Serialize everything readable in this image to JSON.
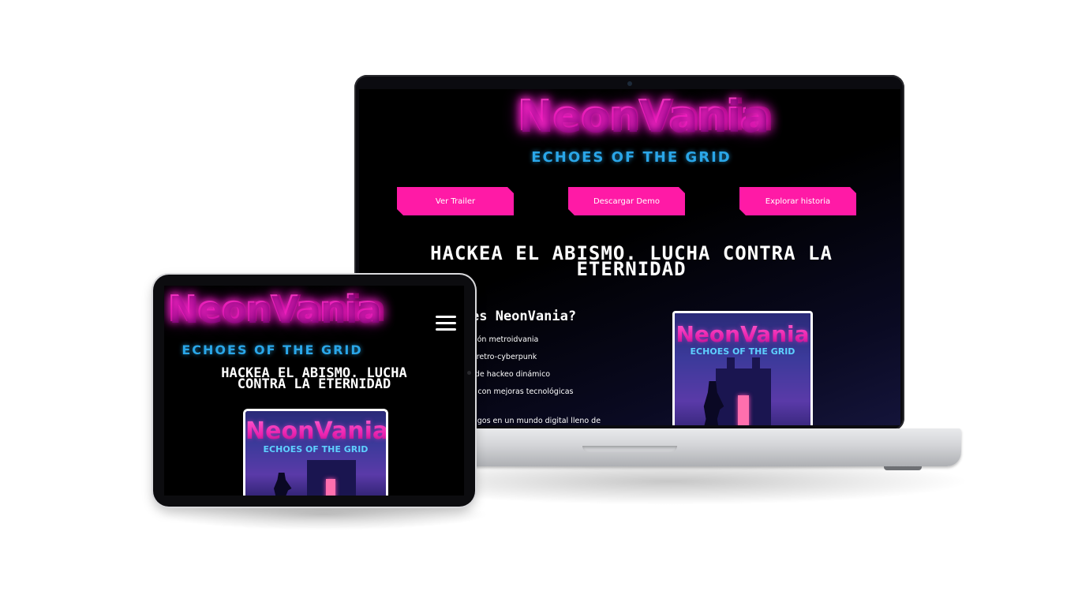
{
  "brand": {
    "title": "NeonVania",
    "subtitle": "ECHOES OF THE GRID"
  },
  "laptop": {
    "buttons": [
      {
        "label": "Ver Trailer"
      },
      {
        "label": "Descargar Demo"
      },
      {
        "label": "Explorar historia"
      }
    ],
    "hero": "HACKEA EL ABISMO. LUCHA CONTRA LA ETERNIDAD",
    "question": "es NeonVania?",
    "features": [
      "ración metroidvania",
      "ica retro-cyberpunk",
      "na de hackeo dinámico",
      "ate con mejoras tecnológicas",
      "emigos en un mundo digital lleno de"
    ]
  },
  "tablet": {
    "hero": "HACKEA EL ABISMO. LUCHA CONTRA LA ETERNIDAD"
  },
  "cover": {
    "title": "NeonVania",
    "subtitle": "ECHOES OF THE GRID"
  },
  "colors": {
    "accent_pink": "#ff1aa6",
    "logo_blue": "#2aa6e8",
    "screen_bg": "#000000"
  },
  "icons": {
    "menu": "hamburger-menu-icon"
  }
}
